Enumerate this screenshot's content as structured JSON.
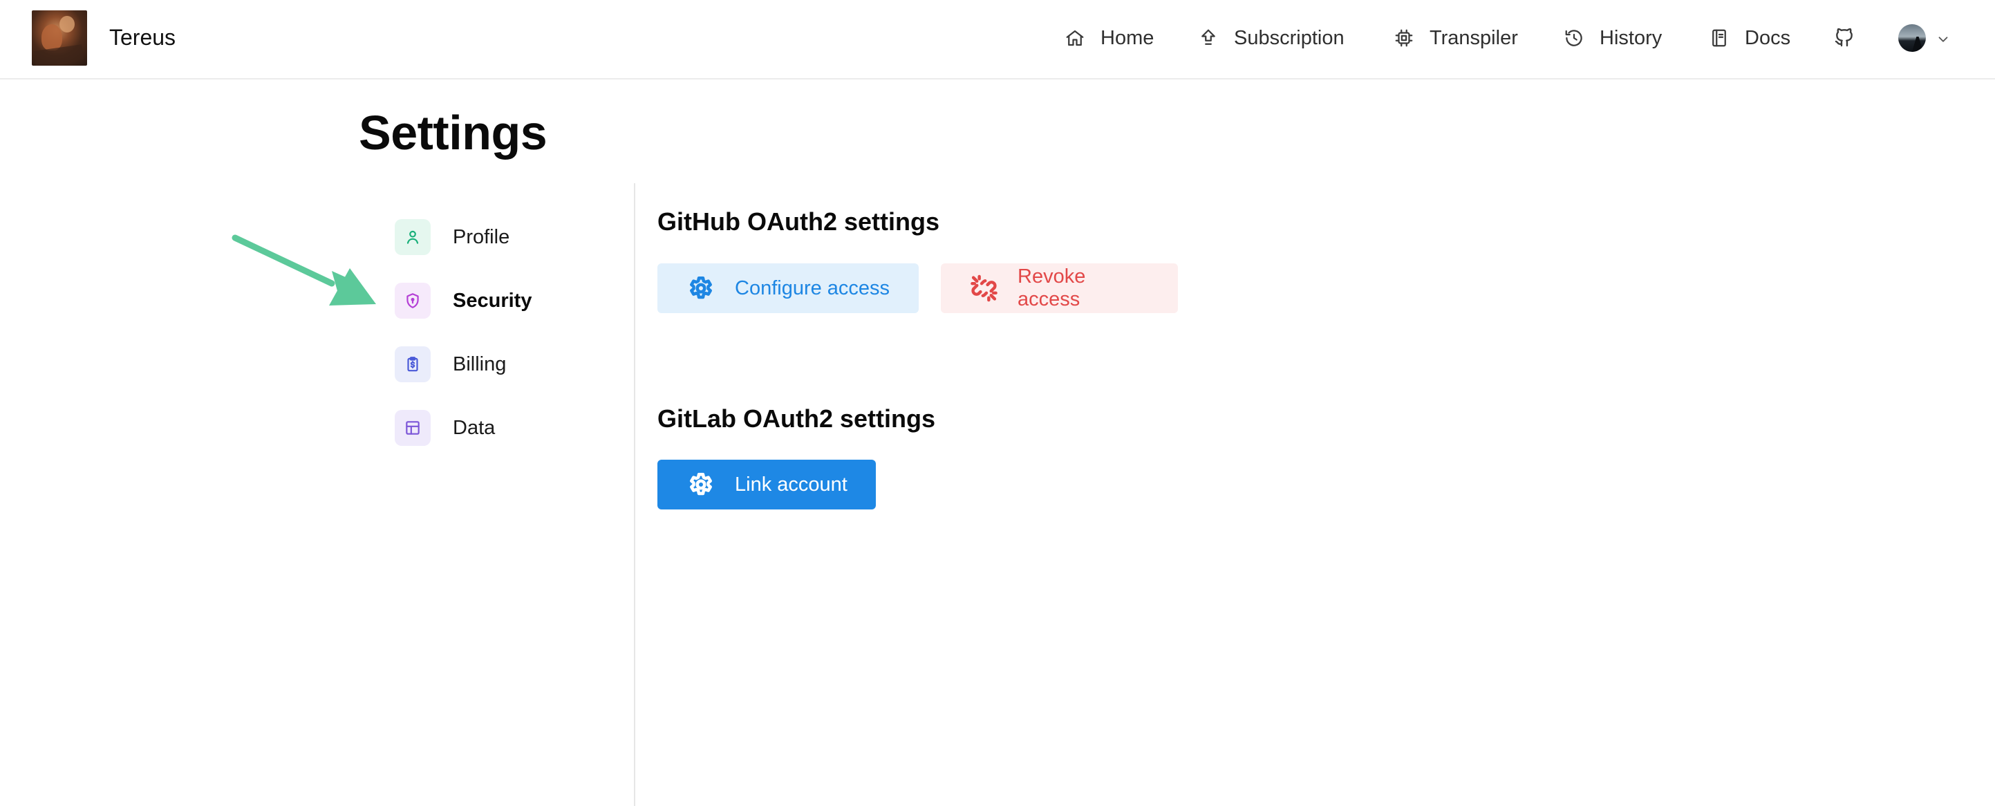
{
  "header": {
    "brand": "Tereus",
    "nav": [
      {
        "label": "Home",
        "icon": "home-icon"
      },
      {
        "label": "Subscription",
        "icon": "upload-icon"
      },
      {
        "label": "Transpiler",
        "icon": "cpu-chip-icon"
      },
      {
        "label": "History",
        "icon": "history-icon"
      },
      {
        "label": "Docs",
        "icon": "book-icon"
      }
    ],
    "github_icon": "github-icon",
    "avatar_menu_icon": "chevron-down-icon"
  },
  "page": {
    "title": "Settings"
  },
  "sidebar": {
    "items": [
      {
        "label": "Profile",
        "icon": "user-icon",
        "icon_color": "#1ab07a",
        "icon_bg": "#e5f7ef",
        "active": false
      },
      {
        "label": "Security",
        "icon": "shield-icon",
        "icon_color": "#b43fd6",
        "icon_bg": "#f6eafb",
        "active": true
      },
      {
        "label": "Billing",
        "icon": "clipboard-dollar-icon",
        "icon_color": "#4a5ad8",
        "icon_bg": "#eaedfb",
        "active": false
      },
      {
        "label": "Data",
        "icon": "table-icon",
        "icon_color": "#7b55d8",
        "icon_bg": "#efeafb",
        "active": false
      }
    ]
  },
  "github_section": {
    "title": "GitHub OAuth2 settings",
    "configure_label": "Configure access",
    "revoke_label": "Revoke access"
  },
  "gitlab_section": {
    "title": "GitLab OAuth2 settings",
    "link_label": "Link account"
  },
  "colors": {
    "primary": "#1e88e5",
    "danger": "#e24848",
    "annotation_arrow": "#5cc99a"
  }
}
